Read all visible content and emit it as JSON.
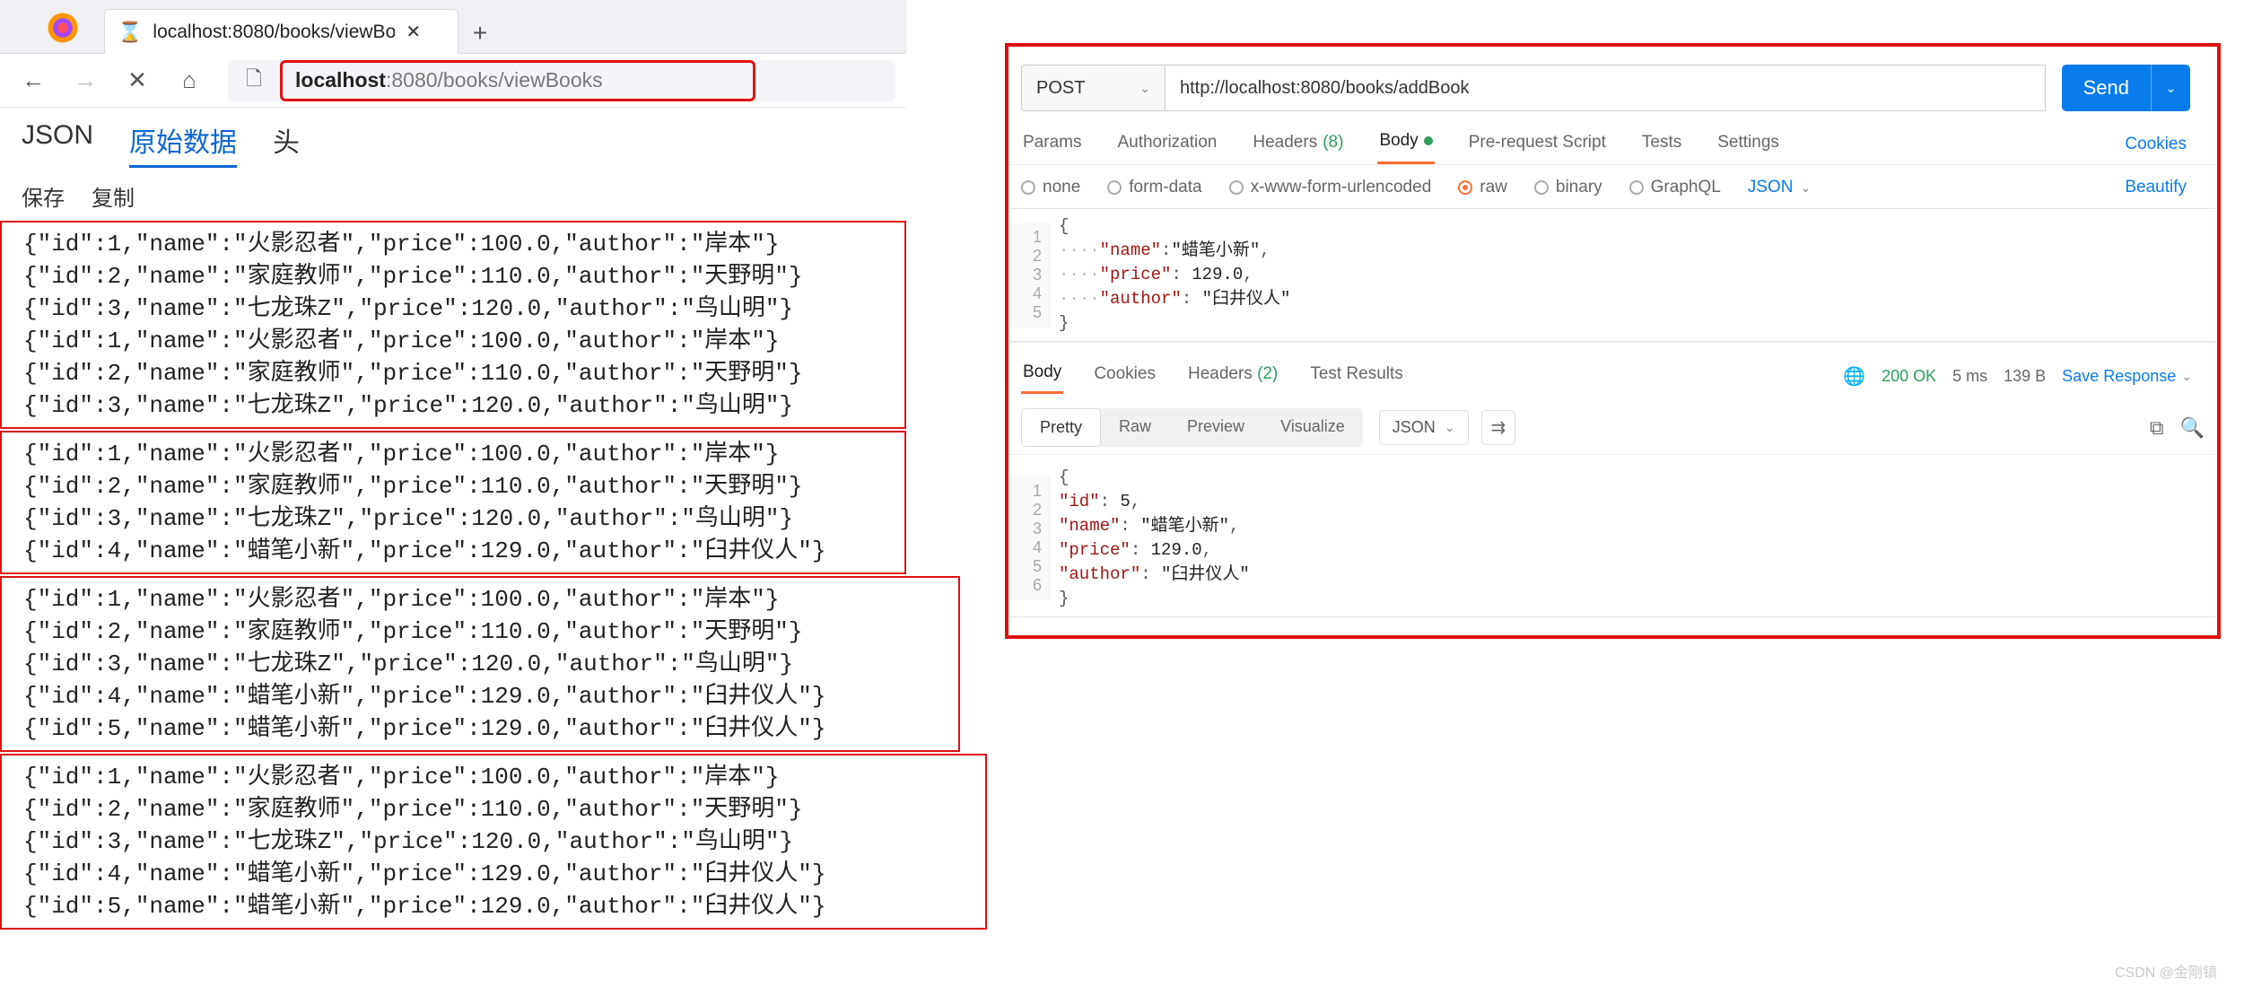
{
  "firefox": {
    "tab_title": "localhost:8080/books/viewBo",
    "url_display_host": "localhost",
    "url_display_rest": ":8080/books/viewBooks",
    "subtabs": {
      "json": "JSON",
      "raw": "原始数据",
      "headers": "头"
    },
    "actions": {
      "save": "保存",
      "copy": "复制"
    },
    "groups": [
      [
        {
          "id": 1,
          "name": "火影忍者",
          "price": 100.0,
          "author": "岸本"
        },
        {
          "id": 2,
          "name": "家庭教师",
          "price": 110.0,
          "author": "天野明"
        },
        {
          "id": 3,
          "name": "七龙珠Z",
          "price": 120.0,
          "author": "鸟山明"
        },
        {
          "id": 1,
          "name": "火影忍者",
          "price": 100.0,
          "author": "岸本"
        },
        {
          "id": 2,
          "name": "家庭教师",
          "price": 110.0,
          "author": "天野明"
        },
        {
          "id": 3,
          "name": "七龙珠Z",
          "price": 120.0,
          "author": "鸟山明"
        }
      ],
      [
        {
          "id": 1,
          "name": "火影忍者",
          "price": 100.0,
          "author": "岸本"
        },
        {
          "id": 2,
          "name": "家庭教师",
          "price": 110.0,
          "author": "天野明"
        },
        {
          "id": 3,
          "name": "七龙珠Z",
          "price": 120.0,
          "author": "鸟山明"
        },
        {
          "id": 4,
          "name": "蜡笔小新",
          "price": 129.0,
          "author": "臼井仪人"
        }
      ],
      [
        {
          "id": 1,
          "name": "火影忍者",
          "price": 100.0,
          "author": "岸本"
        },
        {
          "id": 2,
          "name": "家庭教师",
          "price": 110.0,
          "author": "天野明"
        },
        {
          "id": 3,
          "name": "七龙珠Z",
          "price": 120.0,
          "author": "鸟山明"
        },
        {
          "id": 4,
          "name": "蜡笔小新",
          "price": 129.0,
          "author": "臼井仪人"
        },
        {
          "id": 5,
          "name": "蜡笔小新",
          "price": 129.0,
          "author": "臼井仪人"
        }
      ],
      [
        {
          "id": 1,
          "name": "火影忍者",
          "price": 100.0,
          "author": "岸本"
        },
        {
          "id": 2,
          "name": "家庭教师",
          "price": 110.0,
          "author": "天野明"
        },
        {
          "id": 3,
          "name": "七龙珠Z",
          "price": 120.0,
          "author": "鸟山明"
        },
        {
          "id": 4,
          "name": "蜡笔小新",
          "price": 129.0,
          "author": "臼井仪人"
        },
        {
          "id": 5,
          "name": "蜡笔小新",
          "price": 129.0,
          "author": "臼井仪人"
        }
      ]
    ]
  },
  "postman": {
    "method": "POST",
    "url": "http://localhost:8080/books/addBook",
    "send": "Send",
    "tabs": {
      "params": "Params",
      "auth": "Authorization",
      "headers": "Headers",
      "headers_count": "(8)",
      "body": "Body",
      "prerequest": "Pre-request Script",
      "tests": "Tests",
      "settings": "Settings",
      "cookies": "Cookies"
    },
    "body_types": {
      "none": "none",
      "form": "form-data",
      "xform": "x-www-form-urlencoded",
      "raw": "raw",
      "binary": "binary",
      "graphql": "GraphQL",
      "lang": "JSON",
      "beautify": "Beautify"
    },
    "request_body_lines": [
      "{",
      "····\"name\":\"蜡笔小新\",",
      "····\"price\": 129.0,",
      "····\"author\": \"臼井仪人\"",
      "}"
    ],
    "response_tabs": {
      "body": "Body",
      "cookies": "Cookies",
      "headers": "Headers",
      "headers_count": "(2)",
      "test_results": "Test Results"
    },
    "status": {
      "code": "200 OK",
      "time": "5 ms",
      "size": "139 B",
      "save": "Save Response"
    },
    "view": {
      "pretty": "Pretty",
      "raw": "Raw",
      "preview": "Preview",
      "visualize": "Visualize",
      "lang": "JSON"
    },
    "response_body_lines": [
      "{",
      "    \"id\": 5,",
      "    \"name\": \"蜡笔小新\",",
      "    \"price\": 129.0,",
      "    \"author\": \"臼井仪人\"",
      "}"
    ]
  },
  "watermark": "CSDN @金剛镇"
}
